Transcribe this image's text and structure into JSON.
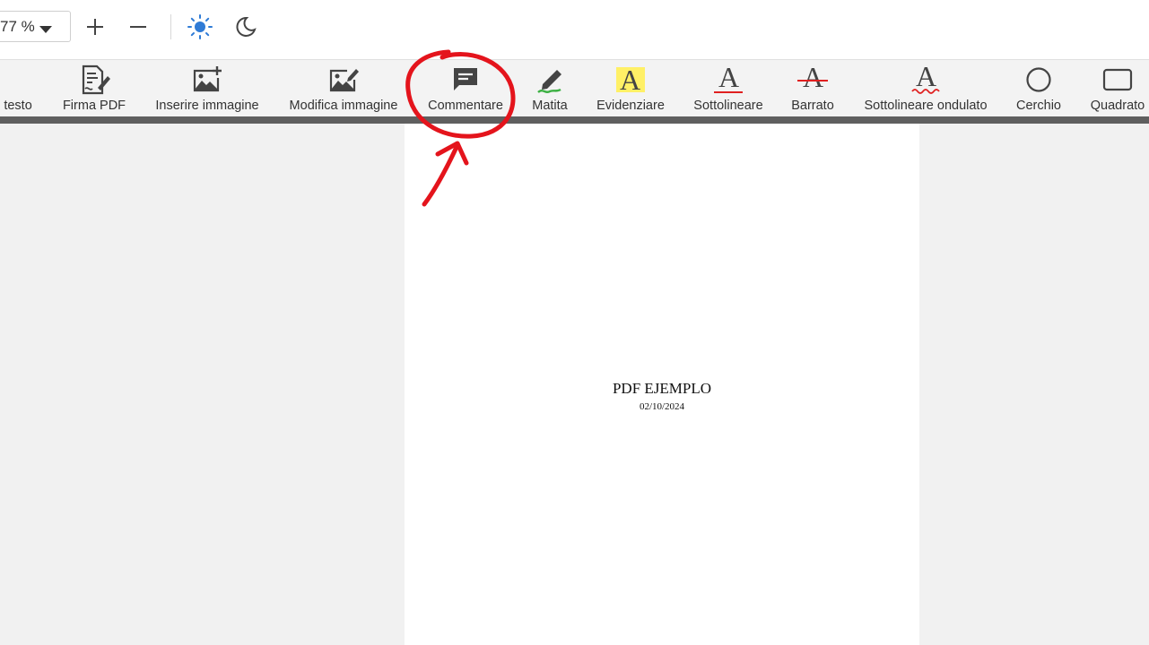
{
  "topbar": {
    "zoom_value": "77 %",
    "zoom_in_icon": "plus-icon",
    "zoom_out_icon": "minus-icon",
    "light_mode_icon": "sun-icon",
    "dark_mode_icon": "moon-icon",
    "accent_color": "#2f7bd6"
  },
  "toolbar": {
    "items": [
      {
        "label": "e testo",
        "icon": "text-icon"
      },
      {
        "label": "Firma PDF",
        "icon": "signature-icon"
      },
      {
        "label": "Inserire immagine",
        "icon": "insert-image-icon"
      },
      {
        "label": "Modifica immagine",
        "icon": "edit-image-icon"
      },
      {
        "label": "Commentare",
        "icon": "comment-icon"
      },
      {
        "label": "Matita",
        "icon": "pencil-icon"
      },
      {
        "label": "Evidenziare",
        "icon": "highlight-icon"
      },
      {
        "label": "Sottolineare",
        "icon": "underline-icon"
      },
      {
        "label": "Barrato",
        "icon": "strikethrough-icon"
      },
      {
        "label": "Sottolineare ondulato",
        "icon": "wavy-underline-icon"
      },
      {
        "label": "Cerchio",
        "icon": "circle-icon"
      },
      {
        "label": "Quadrato",
        "icon": "square-icon"
      }
    ],
    "letter": "A",
    "highlight_color": "#fff066",
    "underline_color": "#e02020",
    "pencil_stroke_color": "#3cb043"
  },
  "document": {
    "title": "PDF EJEMPLO",
    "date": "02/10/2024"
  },
  "annotation": {
    "color": "#e4141c"
  }
}
